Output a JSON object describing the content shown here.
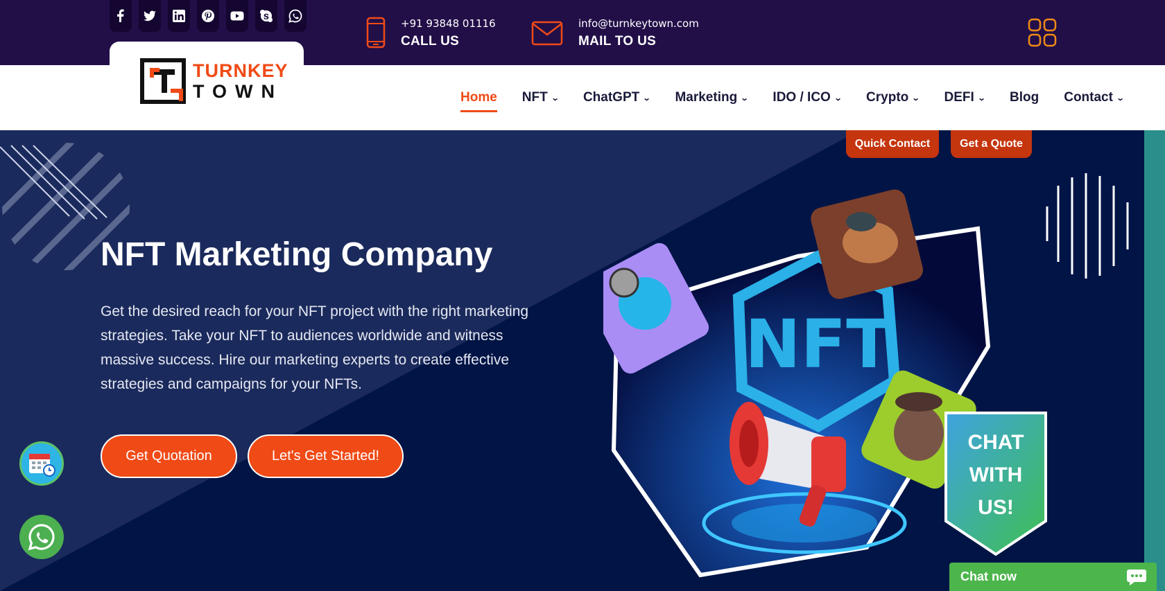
{
  "topbar": {
    "social_icons": [
      "facebook-icon",
      "twitter-icon",
      "linkedin-icon",
      "pinterest-icon",
      "youtube-icon",
      "skype-icon",
      "whatsapp-icon"
    ],
    "phone": {
      "number": "+91 93848 01116",
      "label": "CALL US"
    },
    "mail": {
      "address": "info@turnkeytown.com",
      "label": "MAIL TO US"
    }
  },
  "logo": {
    "line1": "TURNKEY",
    "line2": "TOWN"
  },
  "nav": {
    "items": [
      {
        "label": "Home"
      },
      {
        "label": "NFT"
      },
      {
        "label": "ChatGPT"
      },
      {
        "label": "Marketing"
      },
      {
        "label": "IDO / ICO"
      },
      {
        "label": "Crypto"
      },
      {
        "label": "DEFI"
      },
      {
        "label": "Blog"
      },
      {
        "label": "Contact"
      }
    ]
  },
  "quick_links": {
    "quick_contact": "Quick Contact",
    "get_quote": "Get a Quote"
  },
  "hero": {
    "title": "NFT Marketing Company",
    "text": "Get the desired reach for your NFT project with the right marketing strategies. Take your NFT to audiences worldwide and witness massive success. Hire our marketing experts to create effective strategies and campaigns for your NFTs.",
    "btn_quote": "Get Quotation",
    "btn_started": "Let's Get Started!",
    "nft_logo_text": "NFT"
  },
  "chat": {
    "badge_line1": "CHAT",
    "badge_line2": "WITH",
    "badge_line3": "US!",
    "chat_now": "Chat now"
  },
  "colors": {
    "accent": "#f04a16",
    "topbar": "#220f48",
    "hero": "#001445",
    "chat": "#4cb54c"
  }
}
